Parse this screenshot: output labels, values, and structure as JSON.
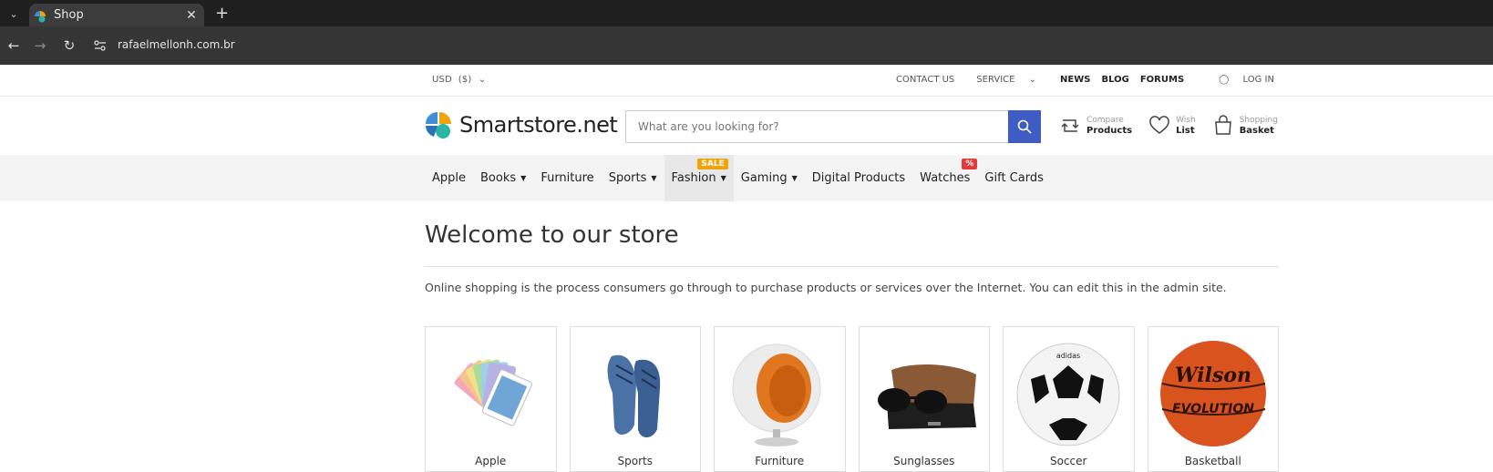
{
  "browser": {
    "tab_title": "Shop",
    "url": "rafaelmellonh.com.br"
  },
  "topbar": {
    "currency": "USD  ($)",
    "contact": "CONTACT US",
    "service": "SERVICE",
    "news": "NEWS",
    "blog": "BLOG",
    "forums": "FORUMS",
    "login": "LOG IN"
  },
  "header": {
    "logo_text_bold": "Smartstore",
    "logo_text_rest": ".net",
    "search_placeholder": "What are you looking for?",
    "tools": [
      {
        "top": "Compare",
        "bottom": "Products",
        "icon": "compare-icon"
      },
      {
        "top": "Wish",
        "bottom": "List",
        "icon": "heart-icon"
      },
      {
        "top": "Shopping",
        "bottom": "Basket",
        "icon": "basket-icon"
      }
    ]
  },
  "menu": {
    "items": [
      {
        "label": "Apple"
      },
      {
        "label": "Books"
      },
      {
        "label": "Furniture"
      },
      {
        "label": "Sports"
      },
      {
        "label": "Fashion",
        "badge": "SALE"
      },
      {
        "label": "Gaming"
      },
      {
        "label": "Digital Products"
      },
      {
        "label": "Watches",
        "badge": "%"
      },
      {
        "label": "Gift Cards"
      }
    ]
  },
  "main": {
    "title": "Welcome to our store",
    "intro": "Online shopping is the process consumers go through to purchase products or services over the Internet. You can edit this in the admin site.",
    "categories": [
      {
        "title": "Apple"
      },
      {
        "title": "Sports"
      },
      {
        "title": "Furniture"
      },
      {
        "title": "Sunglasses"
      },
      {
        "title": "Soccer"
      },
      {
        "title": "Basketball"
      }
    ]
  },
  "colors": {
    "accent": "#3f5bc4",
    "sale_badge": "#f0a30a",
    "percent_badge": "#e23b3b"
  }
}
